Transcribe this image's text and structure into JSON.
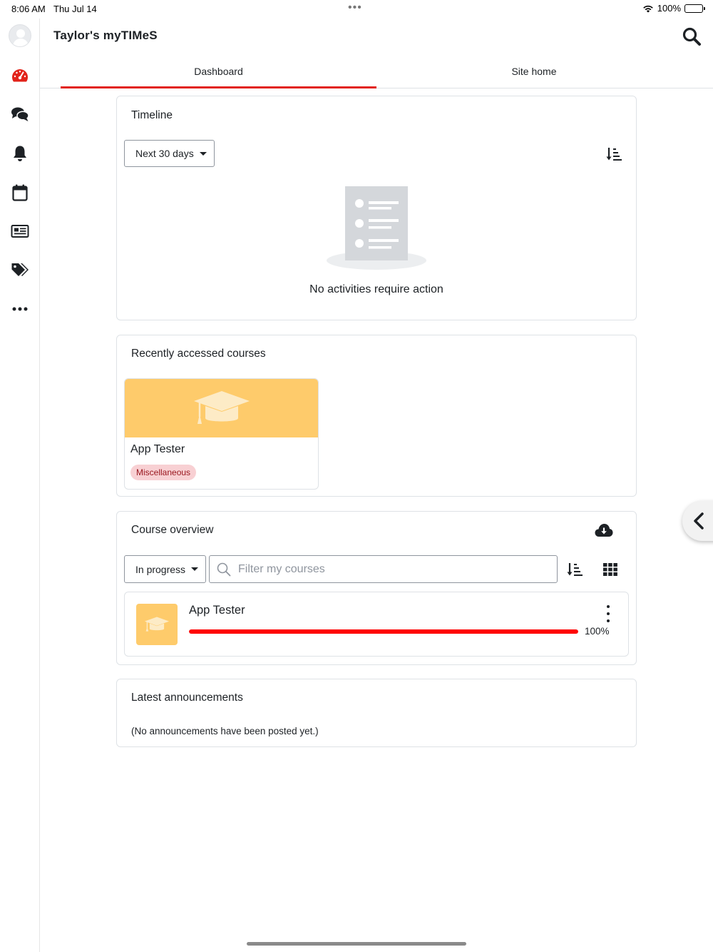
{
  "status_bar": {
    "time": "8:06 AM",
    "date": "Thu Jul 14",
    "battery": "100%"
  },
  "app": {
    "title": "Taylor's myTIMeS"
  },
  "colors": {
    "accent": "#e2231a",
    "course_color": "#fecb6b",
    "badge_bg": "#f8d0d3",
    "badge_text": "#98141c",
    "progress": "#ff0000"
  },
  "rail": {
    "icons": [
      "avatar",
      "dashboard-icon",
      "messages-icon",
      "notifications-icon",
      "calendar-icon",
      "news-icon",
      "tags-icon",
      "more-icon"
    ]
  },
  "tabs": [
    {
      "label": "Dashboard",
      "active": true
    },
    {
      "label": "Site home",
      "active": false
    }
  ],
  "timeline": {
    "title": "Timeline",
    "filter_label": "Next 30 days",
    "empty_message": "No activities require action"
  },
  "recent_courses": {
    "title": "Recently accessed courses",
    "items": [
      {
        "name": "App Tester",
        "category": "Miscellaneous"
      }
    ]
  },
  "course_overview": {
    "title": "Course overview",
    "filter_label": "In progress",
    "search_placeholder": "Filter my courses",
    "courses": [
      {
        "name": "App Tester",
        "progress": 100,
        "progress_text": "100%"
      }
    ]
  },
  "announcements": {
    "title": "Latest announcements",
    "empty_message": "(No announcements have been posted yet.)"
  }
}
